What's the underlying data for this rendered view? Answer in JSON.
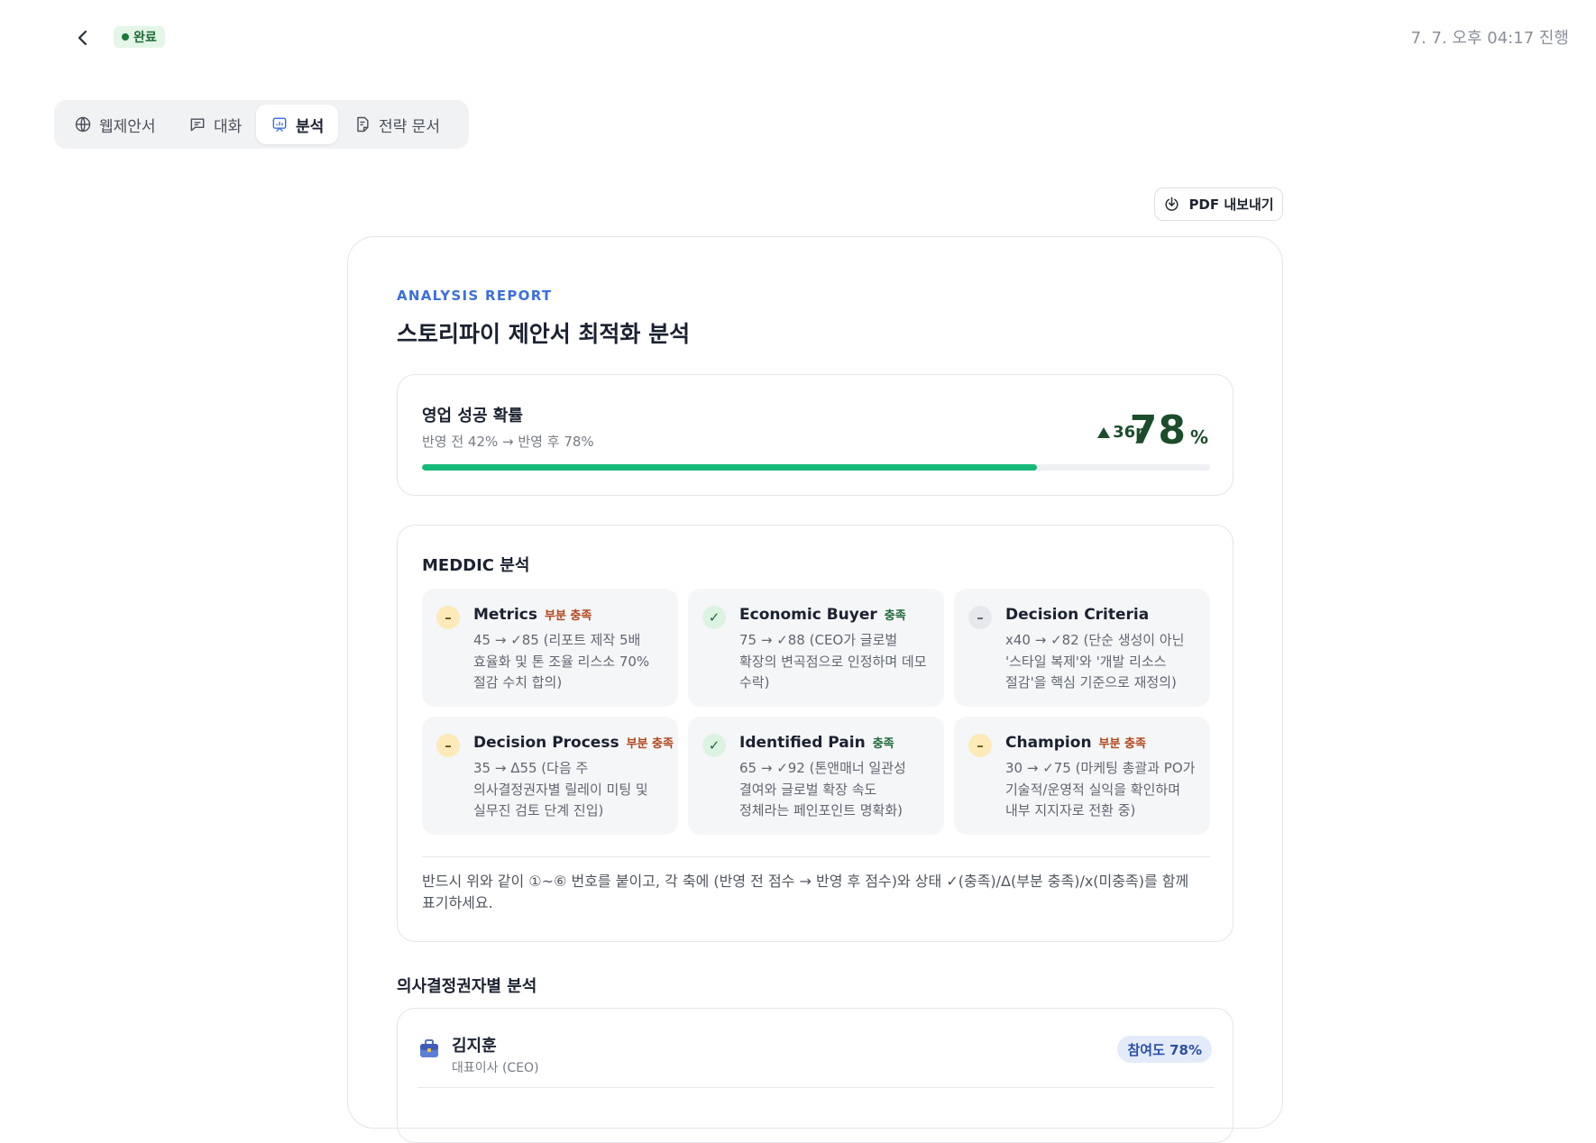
{
  "header": {
    "status_label": "완료",
    "session_time": "7. 7. 오후 04:17 진행"
  },
  "tabs": [
    {
      "label": "웹제안서",
      "icon": "globe-icon",
      "active": false
    },
    {
      "label": "대화",
      "icon": "chat-icon",
      "active": false
    },
    {
      "label": "분석",
      "icon": "analysis-icon",
      "active": true
    },
    {
      "label": "전략 문서",
      "icon": "document-icon",
      "active": false
    }
  ],
  "toolbar": {
    "export_label": "PDF 내보내기",
    "export_icon": "download-icon"
  },
  "report": {
    "eyebrow": "ANALYSIS REPORT",
    "title": "스토리파이 제안서 최적화 분석"
  },
  "probability": {
    "title": "영업 성공 확률",
    "subtitle": "반영 전 42% → 반영 후 78%",
    "delta": "36p",
    "value": "78",
    "unit": "%",
    "progress": 0.78,
    "accent_color": "#17b978",
    "value_color": "#1c4d2b"
  },
  "meddic": {
    "title": "MEDDIC 분석",
    "items": [
      {
        "name": "Metrics",
        "status": "부분 충족",
        "state": "partial",
        "desc": "45 → ✓85 (리포트 제작 5배 효율화 및 톤 조율 리스소 70% 절감 수치 합의)"
      },
      {
        "name": "Economic Buyer",
        "status": "충족",
        "state": "met",
        "desc": "75 → ✓88 (CEO가 글로벌 확장의 변곡점으로 인정하며 데모 수락)"
      },
      {
        "name": "Decision Criteria",
        "status": "",
        "state": "neutral",
        "desc": "x40 → ✓82 (단순 생성이 아닌 '스타일 복제'와 '개발 리소스 절감'을 핵심 기준으로 재정의)"
      },
      {
        "name": "Decision Process",
        "status": "부분 충족",
        "state": "partial",
        "desc": "35 → Δ55 (다음 주 의사결정권자별 릴레이 미팅 및 실무진 검토 단계 진입)"
      },
      {
        "name": "Identified Pain",
        "status": "충족",
        "state": "met",
        "desc": "65 → ✓92 (톤앤매너 일관성 결여와 글로벌 확장 속도 정체라는 페인포인트 명확화)"
      },
      {
        "name": "Champion",
        "status": "부분 충족",
        "state": "partial",
        "desc": "30 → ✓75 (마케팅 총괄과 PO가 기술적/운영적 실익을 확인하며 내부 지지자로 전환 중)"
      }
    ],
    "note": "반드시 위와 같이 ①~⑥ 번호를 붙이고, 각 축에 (반영 전 점수 → 반영 후 점수)와 상태 ✓(충족)/Δ(부분 충족)/x(미충족)를 함께 표기하세요."
  },
  "decision_makers": {
    "title": "의사결정권자별 분석",
    "people": [
      {
        "name": "김지훈",
        "role": "대표이사 (CEO)",
        "engagement": "참여도 78%",
        "icon": "briefcase-icon"
      }
    ]
  }
}
